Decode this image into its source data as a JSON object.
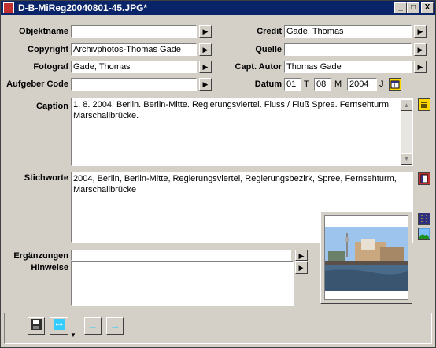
{
  "window": {
    "title": "D-B-MiReg20040801-45.JPG*"
  },
  "titlebar_buttons": {
    "minimize": "_",
    "maximize": "□",
    "close": "X"
  },
  "fields": {
    "objektname": {
      "label": "Objektname",
      "value": ""
    },
    "copyright": {
      "label": "Copyright",
      "value": "Archivphotos-Thomas Gade"
    },
    "fotograf": {
      "label": "Fotograf",
      "value": "Gade, Thomas"
    },
    "aufgeber_code": {
      "label": "Aufgeber Code",
      "value": ""
    },
    "credit": {
      "label": "Credit",
      "value": "Gade, Thomas"
    },
    "quelle": {
      "label": "Quelle",
      "value": ""
    },
    "capt_autor": {
      "label": "Capt. Autor",
      "value": "Thomas Gade"
    },
    "datum": {
      "label": "Datum",
      "day": "01",
      "t_label": "T",
      "month": "08",
      "m_label": "M",
      "year": "2004",
      "j_label": "J"
    }
  },
  "caption": {
    "label": "Caption",
    "value": "1. 8. 2004. Berlin. Berlin-Mitte. Regierungsviertel. Fluss / Fluß Spree. Fernsehturm. Marschallbrücke."
  },
  "stichworte": {
    "label": "Stichworte",
    "value": "2004, Berlin, Berlin-Mitte, Regierungsviertel, Regierungsbezirk, Spree, Fernsehturm, Marschallbrücke"
  },
  "ergaenzungen": {
    "label": "Ergänzungen",
    "value": ""
  },
  "hinweise": {
    "label": "Hinweise",
    "value": ""
  },
  "icons": {
    "arrow": "▶",
    "scroll_up": "▲",
    "scroll_down": "▼",
    "calendar": "calendar-icon",
    "save": "save-icon",
    "prev": "←",
    "next": "→"
  },
  "colors": {
    "titlebar": "#0a246a",
    "window": "#d4d0c8",
    "accent_arrow": "#33ccff"
  }
}
